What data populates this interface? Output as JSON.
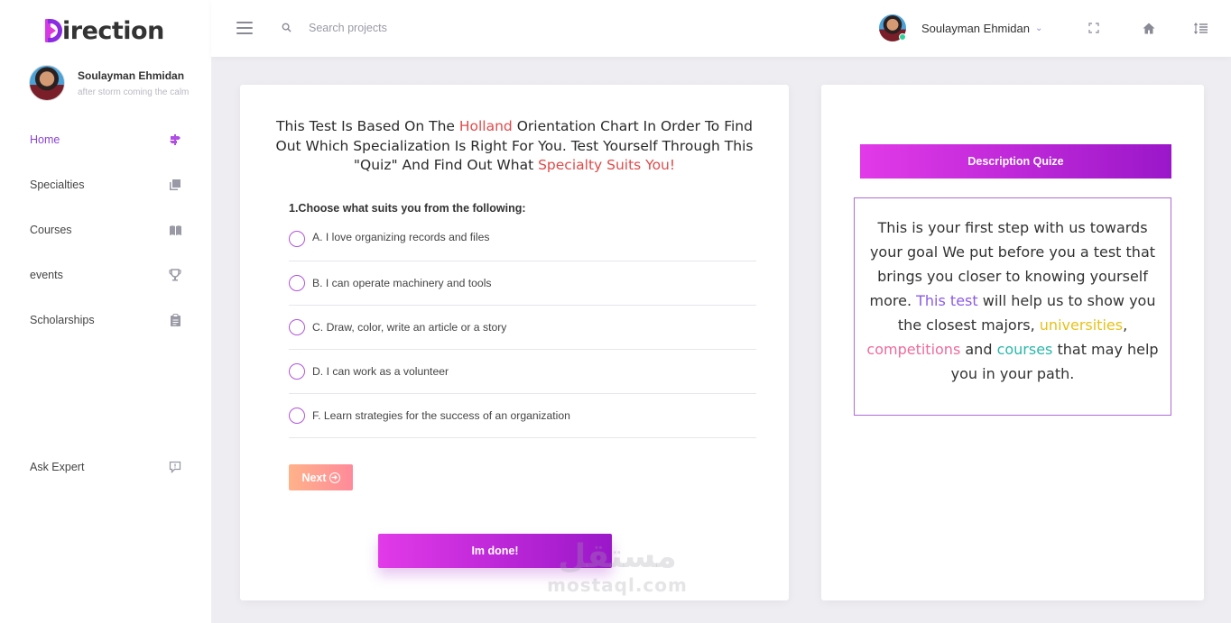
{
  "app": {
    "logo_text": "irection"
  },
  "sidebar": {
    "profile": {
      "name": "Soulayman Ehmidan",
      "subtitle": "after storm coming the calm"
    },
    "items": [
      {
        "label": "Home",
        "icon": "signpost-icon",
        "active": true
      },
      {
        "label": "Specialties",
        "icon": "stack-icon"
      },
      {
        "label": "Courses",
        "icon": "book-icon"
      },
      {
        "label": "events",
        "icon": "trophy-icon"
      },
      {
        "label": "Scholarships",
        "icon": "clipboard-icon"
      }
    ],
    "ask_expert": {
      "label": "Ask Expert",
      "icon": "chat-icon"
    }
  },
  "header": {
    "search_placeholder": "Search projects",
    "user_name": "Soulayman Ehmidan",
    "icons": [
      "menu-icon",
      "search-icon",
      "fullscreen-icon",
      "home-icon",
      "list-indent-icon"
    ]
  },
  "quiz": {
    "title_part1": "This Test Is Based On The ",
    "title_highlight1": "Holland",
    "title_part2": " Orientation Chart In Order To Find Out Which Specialization Is Right For You. Test Yourself Through This \"Quiz\" And Find Out What ",
    "title_highlight2": "Specialty Suits You!",
    "question": "1.Choose what suits you from the following:",
    "options": [
      "A. I love organizing records and files",
      "B. I can operate machinery and tools",
      "C. Draw, color, write an article or a story",
      "D. I can work as a volunteer",
      "F. Learn strategies for the success of an organization"
    ],
    "next_label": "Next",
    "done_label": "Im done!"
  },
  "description": {
    "button_label": "Description Quize",
    "text_part1": "This is your first step with us towards your goal We put before you a test that brings you closer to knowing yourself more. ",
    "text_highlight1": "This test",
    "text_part2": " will help us to show you the closest majors, ",
    "text_universities": "universities",
    "text_comma": ", ",
    "text_competitions": "competitions",
    "text_and": " and ",
    "text_courses": "courses",
    "text_part3": " that may help you in your path."
  },
  "watermark": {
    "arabic": "مستقل",
    "latin": "mostaql.com"
  },
  "colors": {
    "accent": "#8a44d6",
    "gradient_start": "#e23ae8",
    "gradient_end": "#9a17c9",
    "highlight_red": "#e04a4a"
  }
}
